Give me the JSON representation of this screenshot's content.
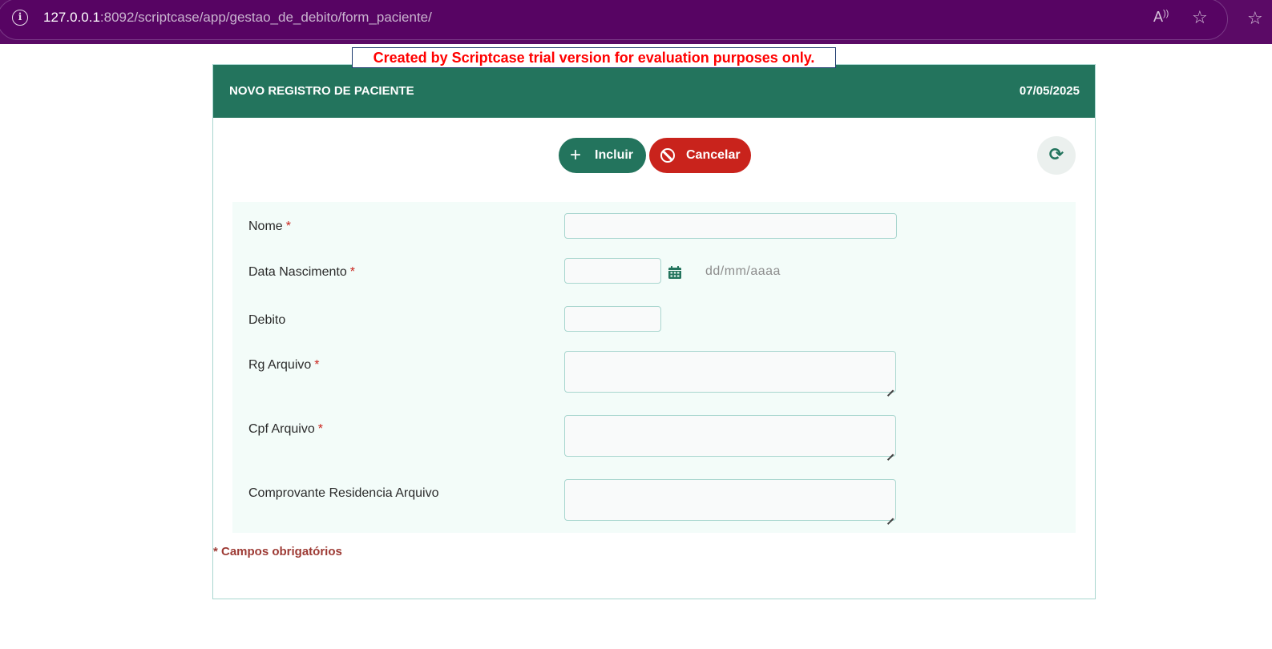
{
  "browser": {
    "url_host": "127.0.0.1",
    "url_rest": ":8092/scriptcase/app/gestao_de_debito/form_paciente/",
    "read_aloud_label": "A)"
  },
  "trial_banner": "Created by Scriptcase trial version for evaluation purposes only.",
  "form": {
    "title": "NOVO REGISTRO DE PACIENTE",
    "date": "07/05/2025",
    "buttons": {
      "incluir": "Incluir",
      "cancelar": "Cancelar"
    },
    "fields": [
      {
        "label": "Nome",
        "required": "*",
        "value": ""
      },
      {
        "label": "Data Nascimento",
        "required": "*",
        "value": "",
        "hint": "dd/mm/aaaa"
      },
      {
        "label": "Debito",
        "required": "",
        "value": ""
      },
      {
        "label": "Rg Arquivo",
        "required": "*",
        "value": ""
      },
      {
        "label": "Cpf Arquivo",
        "required": "*",
        "value": ""
      },
      {
        "label": "Comprovante Residencia Arquivo",
        "required": "",
        "value": ""
      }
    ],
    "required_note": "* Campos obrigatórios"
  },
  "colors": {
    "browser_bar": "#5b0a66",
    "header_green": "#23745d",
    "cancel_red": "#c9231c",
    "panel_bg": "#f3fcf9",
    "banner_text": "#ff0000"
  },
  "icons": [
    "info-icon",
    "read-aloud-icon",
    "favorite-star-icon",
    "plus-icon",
    "ban-icon",
    "refresh-icon",
    "calendar-icon"
  ]
}
